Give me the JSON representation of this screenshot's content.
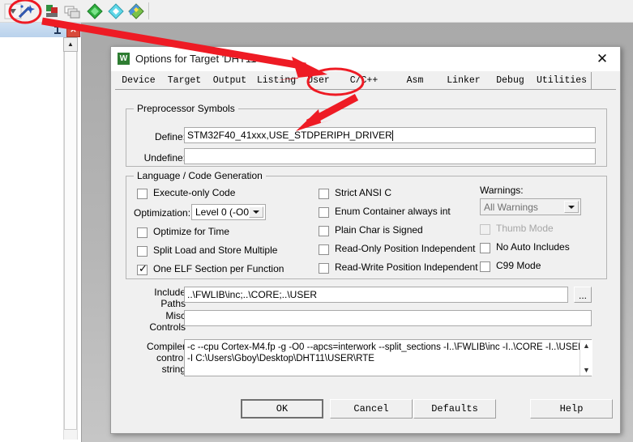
{
  "ide": {
    "toolbar_icons": [
      {
        "name": "dropdown-chevron-icon",
        "glyph": "∨"
      },
      {
        "name": "target-options-magic-wand-icon",
        "glyph": "⚒"
      },
      {
        "name": "manage-run-time-environment-icon",
        "glyph": "◑"
      },
      {
        "name": "batch-build-icon",
        "glyph": "❐"
      },
      {
        "name": "start-debug-session-green-icon",
        "glyph": "◆"
      },
      {
        "name": "configure-flash-tools-cyan-icon",
        "glyph": "▼"
      },
      {
        "name": "download-to-flash-icon",
        "glyph": "◈"
      }
    ],
    "panel": {
      "pin_glyph": "⛏",
      "close_label": "✕",
      "scroll_up_glyph": "▲"
    }
  },
  "dialog": {
    "app_icon_letter": "W",
    "title": "Options for Target 'DHT11'",
    "close_label": "✕",
    "tabs": [
      {
        "label": "Device",
        "active": false
      },
      {
        "label": "Target",
        "active": false
      },
      {
        "label": "Output",
        "active": false
      },
      {
        "label": "Listing",
        "active": false
      },
      {
        "label": "User",
        "active": false
      },
      {
        "label": "C/C++",
        "active": true
      },
      {
        "label": "Asm",
        "active": false
      },
      {
        "label": "Linker",
        "active": false
      },
      {
        "label": "Debug",
        "active": false
      },
      {
        "label": "Utilities",
        "active": false
      }
    ],
    "preprocessor": {
      "legend": "Preprocessor Symbols",
      "define_label": "Define:",
      "define_value": "STM32F40_41xxx,USE_STDPERIPH_DRIVER",
      "undefine_label": "Undefine:",
      "undefine_value": ""
    },
    "language": {
      "legend": "Language / Code Generation",
      "left_column": [
        {
          "label": "Execute-only Code",
          "checked": false,
          "enabled": true
        },
        {
          "label": "Optimize for Time",
          "checked": false,
          "enabled": true
        },
        {
          "label": "Split Load and Store Multiple",
          "checked": false,
          "enabled": true
        },
        {
          "label": "One ELF Section per Function",
          "checked": true,
          "enabled": true
        }
      ],
      "optimization_label": "Optimization:",
      "optimization_value": "Level 0 (-O0)",
      "middle_column": [
        {
          "label": "Strict ANSI C",
          "checked": false,
          "enabled": true
        },
        {
          "label": "Enum Container always int",
          "checked": false,
          "enabled": true
        },
        {
          "label": "Plain Char is Signed",
          "checked": false,
          "enabled": true
        },
        {
          "label": "Read-Only Position Independent",
          "checked": false,
          "enabled": true
        },
        {
          "label": "Read-Write Position Independent",
          "checked": false,
          "enabled": true
        }
      ],
      "warnings_label": "Warnings:",
      "warnings_value": "All Warnings",
      "right_column": [
        {
          "label": "Thumb Mode",
          "checked": false,
          "enabled": false
        },
        {
          "label": "No Auto Includes",
          "checked": false,
          "enabled": true
        },
        {
          "label": "C99 Mode",
          "checked": false,
          "enabled": true
        }
      ]
    },
    "paths": {
      "include_label_line1": "Include",
      "include_label_line2": "Paths",
      "include_value": "..\\FWLIB\\inc;..\\CORE;..\\USER",
      "browse_label": "...",
      "misc_label_line1": "Misc",
      "misc_label_line2": "Controls",
      "misc_value": "",
      "compiler_label_line1": "Compiler",
      "compiler_label_line2": "control",
      "compiler_label_line3": "string",
      "compiler_value_line1": "-c --cpu Cortex-M4.fp -g -O0 --apcs=interwork --split_sections -I..\\FWLIB\\inc -I..\\CORE -I..\\USER",
      "compiler_value_line2": "-I C:\\Users\\Gboy\\Desktop\\DHT11\\USER\\RTE",
      "scroll_up_glyph": "▲",
      "scroll_down_glyph": "▼"
    },
    "buttons": [
      {
        "label": "OK",
        "name": "ok-button",
        "default": true
      },
      {
        "label": "Cancel",
        "name": "cancel-button",
        "default": false
      },
      {
        "label": "Defaults",
        "name": "defaults-button",
        "default": false
      },
      {
        "label": "Help",
        "name": "help-button",
        "default": false
      }
    ]
  },
  "annotations": {
    "accent_color": "#ee1b24",
    "ellipse_toolbar": "circle-around-target-options-icon",
    "ellipse_tab": "circle-around-c-cpp-tab",
    "arrow_to_tab": "arrow-pointing-to-c-cpp-tab",
    "arrow_to_define": "arrow-pointing-to-define-field"
  }
}
